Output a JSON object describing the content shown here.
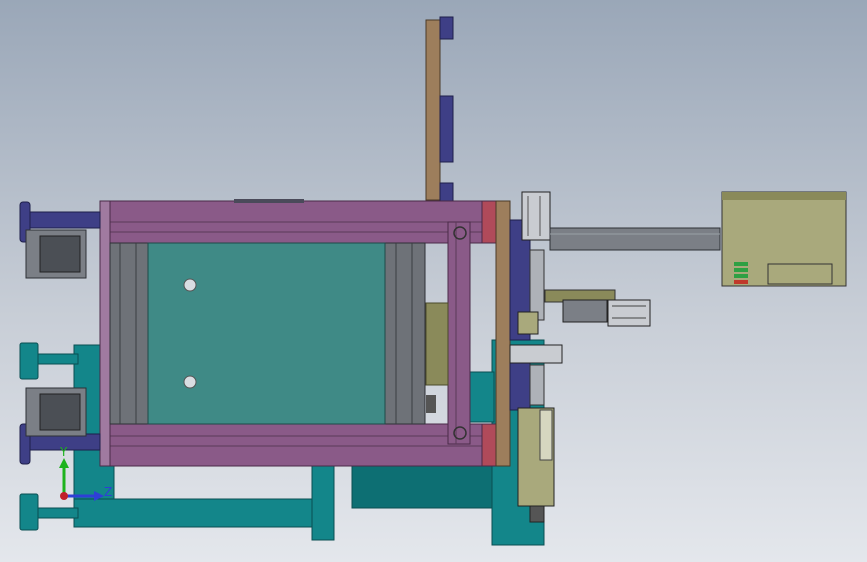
{
  "triad": {
    "y_label": "Y",
    "z_label": "Z"
  },
  "colors": {
    "frame_purple": "#8a5a88",
    "frame_highlight": "#a07aa0",
    "teal": "#13868a",
    "teal_dark": "#0d6f73",
    "panel_green": "#3f8a86",
    "navy": "#3e3f86",
    "wood": "#9d7e5c",
    "grey": "#7b7f86",
    "control_box": "#a9a97c",
    "led_green": "#2ea043",
    "led_red": "#c0392b",
    "axis_y": "#1db31d",
    "axis_z": "#2f3fd6",
    "axis_origin": "#c0202a"
  }
}
